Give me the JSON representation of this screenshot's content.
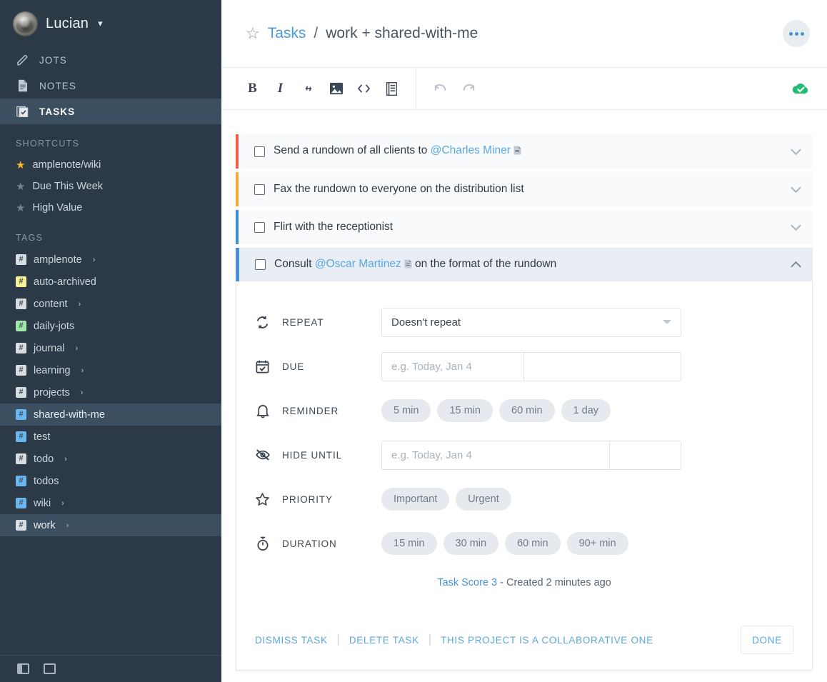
{
  "sidebar": {
    "account": {
      "name": "Lucian",
      "caret": "chevron-down"
    },
    "nav": [
      {
        "label": "JOTS",
        "icon": "pencil-icon",
        "active": false
      },
      {
        "label": "NOTES",
        "icon": "document-icon",
        "active": false
      },
      {
        "label": "TASKS",
        "icon": "tasks-icon",
        "active": true
      }
    ],
    "shortcuts_label": "SHORTCUTS",
    "shortcuts": [
      {
        "label": "amplenote/wiki",
        "starred": true
      },
      {
        "label": "Due This Week",
        "starred": false
      },
      {
        "label": "High Value",
        "starred": false
      }
    ],
    "tags_label": "TAGS",
    "tags": [
      {
        "label": "amplenote",
        "color": "#d8dde2",
        "expandable": true,
        "selected": false
      },
      {
        "label": "auto-archived",
        "color": "#f7f19a",
        "expandable": false,
        "selected": false
      },
      {
        "label": "content",
        "color": "#d8dde2",
        "expandable": true,
        "selected": false
      },
      {
        "label": "daily-jots",
        "color": "#9fe8a8",
        "expandable": false,
        "selected": false
      },
      {
        "label": "journal",
        "color": "#d8dde2",
        "expandable": true,
        "selected": false
      },
      {
        "label": "learning",
        "color": "#d8dde2",
        "expandable": true,
        "selected": false
      },
      {
        "label": "projects",
        "color": "#d8dde2",
        "expandable": true,
        "selected": false
      },
      {
        "label": "shared-with-me",
        "color": "#6ab7ef",
        "expandable": false,
        "selected": true
      },
      {
        "label": "test",
        "color": "#6ab7ef",
        "expandable": false,
        "selected": false
      },
      {
        "label": "todo",
        "color": "#d8dde2",
        "expandable": true,
        "selected": false
      },
      {
        "label": "todos",
        "color": "#6ab7ef",
        "expandable": false,
        "selected": false
      },
      {
        "label": "wiki",
        "color": "#6ab7ef",
        "expandable": true,
        "selected": false
      },
      {
        "label": "work",
        "color": "#d8dde2",
        "expandable": true,
        "selected": true
      }
    ],
    "bottom_icons": [
      {
        "name": "panel-left-toggle"
      },
      {
        "name": "panel-full-toggle"
      }
    ]
  },
  "header": {
    "star_icon": "star-outline-icon",
    "crumb_link": "Tasks",
    "crumb_sep": "/",
    "crumb_rest": "work + shared-with-me",
    "menu_icon": "ellipsis-icon"
  },
  "toolbar": {
    "buttons": [
      {
        "name": "bold-button",
        "label": "B"
      },
      {
        "name": "italic-button",
        "label": "I"
      },
      {
        "name": "link-button",
        "label": "link-icon"
      },
      {
        "name": "image-button",
        "label": "image-icon"
      },
      {
        "name": "code-button",
        "label": "code-icon"
      },
      {
        "name": "note-button",
        "label": "note-icon"
      }
    ],
    "undo": "undo-icon",
    "redo": "redo-icon",
    "sync_status": "cloud-check-icon",
    "sync_color": "#22bd72"
  },
  "tasks": [
    {
      "prefix": "Send a rundown of all clients to ",
      "mention": "@Charles Miner",
      "suffix": "",
      "has_doc_icon": true,
      "bar_color": "#f1604b",
      "chevron": "chevron-down",
      "expanded": false
    },
    {
      "prefix": "Fax the rundown to everyone on the distribution list",
      "mention": "",
      "suffix": "",
      "has_doc_icon": false,
      "bar_color": "#f4ab36",
      "chevron": "chevron-down",
      "expanded": false
    },
    {
      "prefix": "Flirt with the receptionist",
      "mention": "",
      "suffix": "",
      "has_doc_icon": false,
      "bar_color": "#3d8fd1",
      "chevron": "chevron-down",
      "expanded": false
    }
  ],
  "expanded_task": {
    "prefix": "Consult ",
    "mention": "@Oscar Martinez",
    "suffix": " on the format of the rundown",
    "has_doc_icon": true,
    "bar_color": "#4a90d9",
    "chevron": "chevron-up",
    "fields": {
      "repeat": {
        "label": "REPEAT",
        "icon": "repeat-icon",
        "value": "Doesn't repeat"
      },
      "due": {
        "label": "DUE",
        "icon": "calendar-check-icon",
        "placeholder": "e.g. Today, Jan 4",
        "value": ""
      },
      "reminder": {
        "label": "REMINDER",
        "icon": "bell-icon",
        "options": [
          "5 min",
          "15 min",
          "60 min",
          "1 day"
        ]
      },
      "hide_until": {
        "label": "HIDE UNTIL",
        "icon": "eye-off-icon",
        "placeholder": "e.g. Today, Jan 4",
        "value": ""
      },
      "priority": {
        "label": "PRIORITY",
        "icon": "star-icon",
        "options": [
          "Important",
          "Urgent"
        ]
      },
      "duration": {
        "label": "DURATION",
        "icon": "stopwatch-icon",
        "options": [
          "15 min",
          "30 min",
          "60 min",
          "90+ min"
        ]
      }
    },
    "score_link": "Task Score 3",
    "score_rest": " - Created 2 minutes ago",
    "footer": {
      "dismiss": "DISMISS TASK",
      "delete": "DELETE TASK",
      "collaborative": "THIS PROJECT IS A COLLABORATIVE ONE",
      "done": "DONE",
      "sep": "|"
    }
  }
}
